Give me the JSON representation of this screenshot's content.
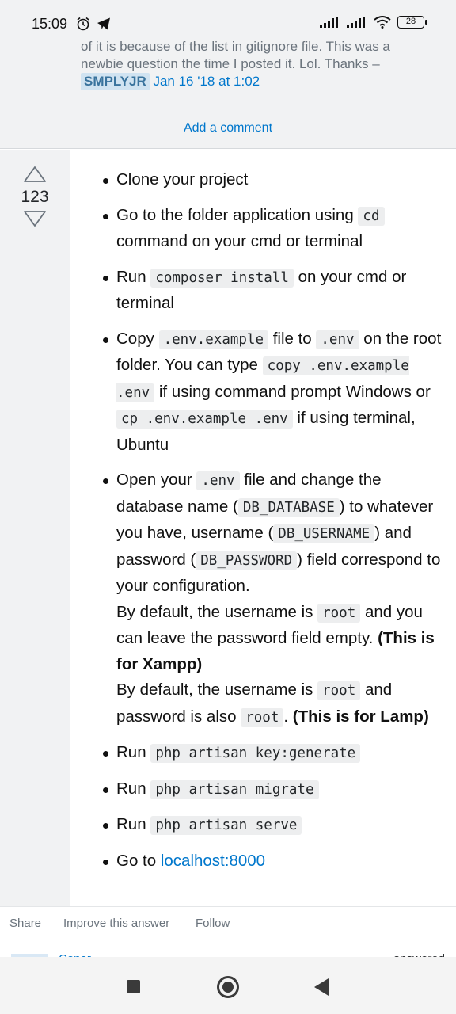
{
  "status_bar": {
    "time": "15:09",
    "battery": "28",
    "icons": [
      "alarm-icon",
      "telegram-icon",
      "signal-icon",
      "signal-icon",
      "wifi-icon",
      "battery-icon"
    ]
  },
  "comment": {
    "line1": "of it is because of the list in gitignore file. This was a",
    "line2": "newbie question the time I posted it. Lol. Thanks –",
    "user": "SMPLYJR",
    "date": "Jan 16 '18 at 1:02"
  },
  "add_comment_label": "Add a comment",
  "answer": {
    "vote_count": "123",
    "items": {
      "i1": {
        "text": "Clone your project"
      },
      "i2": {
        "t1": "Go to the folder application using ",
        "c1": "cd",
        "t2": " command on your cmd or terminal"
      },
      "i3": {
        "t1": "Run ",
        "c1": "composer install",
        "t2": " on your cmd or terminal"
      },
      "i4": {
        "t1": "Copy ",
        "c1": ".env.example",
        "t2": " file to ",
        "c2": ".env",
        "t3": " on the root folder. You can type ",
        "c3": "copy .env.example .env",
        "t4": " if using command prompt Windows or ",
        "c4": "cp .env.example .env",
        "t5": " if using terminal, Ubuntu"
      },
      "i5": {
        "t1": "Open your ",
        "c1": ".env",
        "t2": " file and change the database name (",
        "c2": "DB_DATABASE",
        "t3": ") to whatever you have, username (",
        "c3": "DB_USERNAME",
        "t4": ") and password (",
        "c4": "DB_PASSWORD",
        "t5": ") field correspond to your configuration.",
        "t6": "By default, the username is ",
        "c5": "root",
        "t7": " and you can leave the password field empty. ",
        "b1": "(This is for Xampp)",
        "t8": "By default, the username is ",
        "c6": "root",
        "t9": " and password is also ",
        "c7": "root",
        "t10": ". ",
        "b2": "(This is for Lamp)"
      },
      "i6": {
        "t1": "Run ",
        "c1": "php artisan key:generate"
      },
      "i7": {
        "t1": "Run ",
        "c1": "php artisan migrate"
      },
      "i8": {
        "t1": "Run ",
        "c1": "php artisan serve"
      },
      "i9": {
        "t1": "Go to ",
        "link": "localhost:8000"
      }
    }
  },
  "post_menu": {
    "share": "Share",
    "improve": "Improve this answer",
    "follow": "Follow"
  },
  "next_answer": {
    "name": "Conor",
    "meta": "answered"
  }
}
